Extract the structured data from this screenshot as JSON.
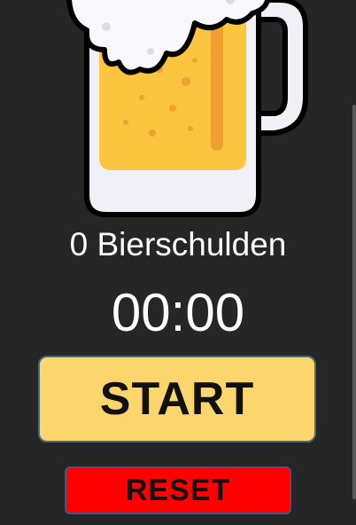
{
  "app": {
    "debt_label": "0 Bierschulden",
    "timer": "00:00"
  },
  "buttons": {
    "start_label": "START",
    "reset_label": "RESET"
  },
  "colors": {
    "background": "#262626",
    "start_button": "#fcd66c",
    "reset_button": "#ff0000",
    "text": "#ffffff"
  },
  "icons": {
    "hero": "beer-mug-icon"
  }
}
